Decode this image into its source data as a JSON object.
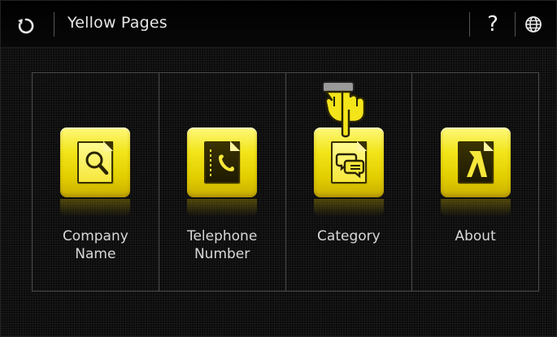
{
  "header": {
    "title": "Yellow Pages",
    "back_icon": "refresh-back-icon",
    "help_label": "?",
    "globe_icon": "globe-icon"
  },
  "menu": {
    "items": [
      {
        "label": "Company\nName",
        "icon": "magnifier-icon"
      },
      {
        "label": "Telephone\nNumber",
        "icon": "phonebook-icon"
      },
      {
        "label": "Category",
        "icon": "speech-bubbles-icon"
      },
      {
        "label": "About",
        "icon": "yellow-pages-logo-icon"
      }
    ]
  },
  "overlay": {
    "pointer_icon": "hand-pointer-icon"
  },
  "colors": {
    "background": "#0b0b0b",
    "tile_yellow": "#f2e51a",
    "text": "#d8d8d8",
    "divider": "#4a4a4a"
  }
}
